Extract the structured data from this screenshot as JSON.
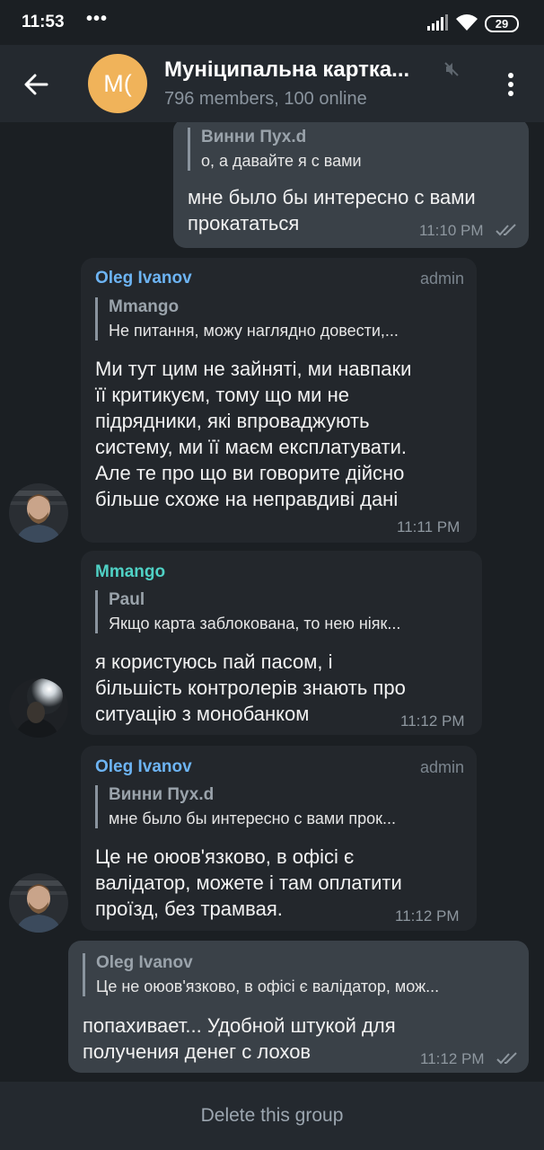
{
  "status_bar": {
    "time": "11:53",
    "dots": "•••",
    "battery": "29"
  },
  "header": {
    "title": "Муніципальна картка...",
    "subtitle": "796 members, 100 online",
    "avatar_initials": "M(",
    "avatar_color": "#f0b35a"
  },
  "messages": [
    {
      "direction": "out",
      "reply_name": "Винни Пух.d",
      "reply_text": "о, а давайте я с вами",
      "text_lines": [
        "мне было бы интересно с вами",
        "прокататься"
      ],
      "time": "11:10 PM",
      "read": true
    },
    {
      "direction": "in",
      "sender": "Oleg Ivanov",
      "role": "admin",
      "reply_name": "Mmango",
      "reply_text": "Не питання, можу наглядно довести,...",
      "text_lines": [
        "Ми тут цим не зайняті, ми навпаки",
        "її критикуєм, тому що ми не",
        "підрядники, які впроваджують",
        "систему, ми її маєм експлатувати.",
        "Але те про що ви говорите дійсно",
        "більше схоже на неправдиві дані"
      ],
      "time": "11:11 PM"
    },
    {
      "direction": "in",
      "sender": "Mmango",
      "reply_name": "Paul",
      "reply_text": "Якщо карта заблокована, то нею ніяк...",
      "text_lines": [
        "я користуюсь пай пасом, і",
        "більшість контролерів знають про",
        "ситуацію з монобанком"
      ],
      "time": "11:12 PM"
    },
    {
      "direction": "in",
      "sender": "Oleg Ivanov",
      "role": "admin",
      "reply_name": "Винни Пух.d",
      "reply_text": "мне было бы интересно с вами прок...",
      "text_lines": [
        "Це не оюов'язково, в офісі є",
        "валідатор, можете і там оплатити",
        "проїзд, без трамвая."
      ],
      "time": "11:12 PM"
    },
    {
      "direction": "out",
      "reply_name": "Oleg Ivanov",
      "reply_text": "Це не оюов'язково, в офісі є валідатор, мож...",
      "text_lines": [
        "попахивает... Удобной штукой для",
        "получения денег с лохов"
      ],
      "time": "11:12 PM",
      "read": true
    }
  ],
  "bottom": {
    "delete_label": "Delete this group"
  },
  "colors": {
    "accent_blue": "#6db4f3",
    "accent_green": "#4fd1c5",
    "background": "#1b1f23"
  }
}
